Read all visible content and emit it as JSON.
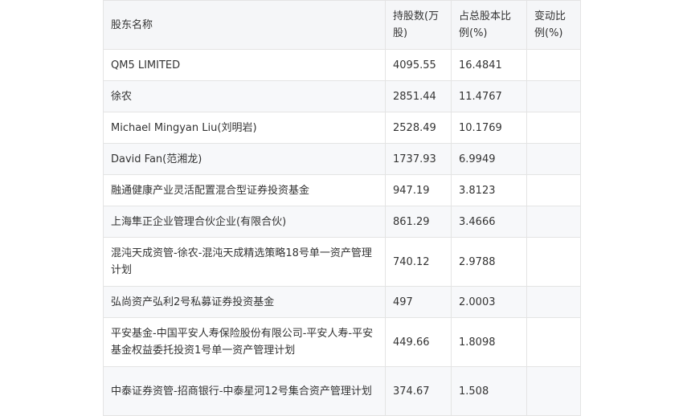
{
  "table": {
    "headers": [
      "股东名称",
      "持股数(万股)",
      "占总股本比例(%)",
      "变动比例(%)"
    ],
    "rows": [
      {
        "name": "QM5 LIMITED",
        "shares": "4095.55",
        "ratio": "16.4841",
        "change": ""
      },
      {
        "name": "徐农",
        "shares": "2851.44",
        "ratio": "11.4767",
        "change": ""
      },
      {
        "name": "Michael Mingyan Liu(刘明岩)",
        "shares": "2528.49",
        "ratio": "10.1769",
        "change": ""
      },
      {
        "name": "David Fan(范湘龙)",
        "shares": "1737.93",
        "ratio": "6.9949",
        "change": ""
      },
      {
        "name": "融通健康产业灵活配置混合型证券投资基金",
        "shares": "947.19",
        "ratio": "3.8123",
        "change": ""
      },
      {
        "name": "上海隼正企业管理合伙企业(有限合伙)",
        "shares": "861.29",
        "ratio": "3.4666",
        "change": ""
      },
      {
        "name": "混沌天成资管-徐农-混沌天成精选策略18号单一资产管理计划",
        "shares": "740.12",
        "ratio": "2.9788",
        "change": ""
      },
      {
        "name": "弘尚资产弘利2号私募证券投资基金",
        "shares": "497",
        "ratio": "2.0003",
        "change": ""
      },
      {
        "name": "平安基金-中国平安人寿保险股份有限公司-平安人寿-平安基金权益委托投资1号单一资产管理计划",
        "shares": "449.66",
        "ratio": "1.8098",
        "change": ""
      },
      {
        "name": "中泰证券资管-招商银行-中泰星河12号集合资产管理计划",
        "shares": "374.67",
        "ratio": "1.508",
        "change": ""
      }
    ]
  }
}
